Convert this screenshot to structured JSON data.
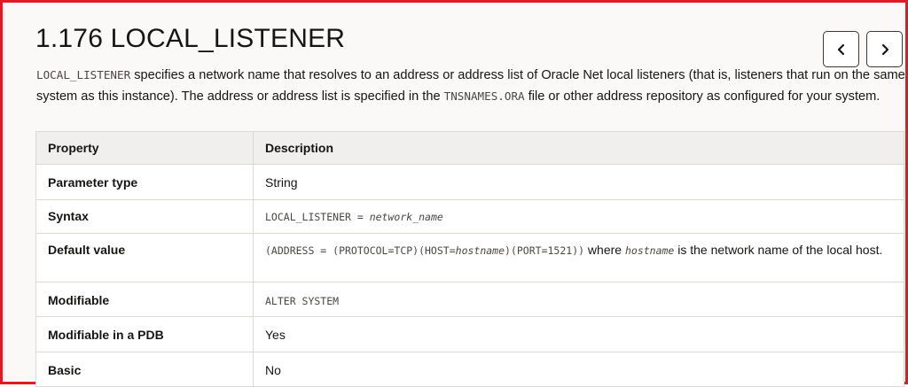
{
  "page": {
    "title": "1.176 LOCAL_LISTENER",
    "nav": {
      "prev_icon": "chevron-left-icon",
      "next_icon": "chevron-right-icon"
    }
  },
  "intro": {
    "code1": "LOCAL_LISTENER",
    "text1": " specifies a network name that resolves to an address or address list of Oracle Net local listeners (that is, listeners that run on the same system as this instance). The address or address list is specified in the ",
    "code2": "TNSNAMES.ORA",
    "text2": " file or other address repository as configured for your system."
  },
  "table": {
    "headers": {
      "property": "Property",
      "description": "Description"
    },
    "rows": {
      "param_type": {
        "label": "Parameter type",
        "value": "String"
      },
      "syntax": {
        "label": "Syntax",
        "code": "LOCAL_LISTENER = ",
        "code_italic": "network_name"
      },
      "default": {
        "label": "Default value",
        "code_a": "(ADDRESS = (PROTOCOL=TCP)(HOST=",
        "code_i": "hostname",
        "code_b": ")(PORT=1521))",
        "text_a": " where ",
        "text_code": "hostname",
        "text_b": " is the network name of the local host."
      },
      "modifiable": {
        "label": "Modifiable",
        "code": "ALTER SYSTEM"
      },
      "pdb": {
        "label": "Modifiable in a PDB",
        "value": "Yes"
      },
      "basic": {
        "label": "Basic",
        "value": "No"
      }
    }
  }
}
